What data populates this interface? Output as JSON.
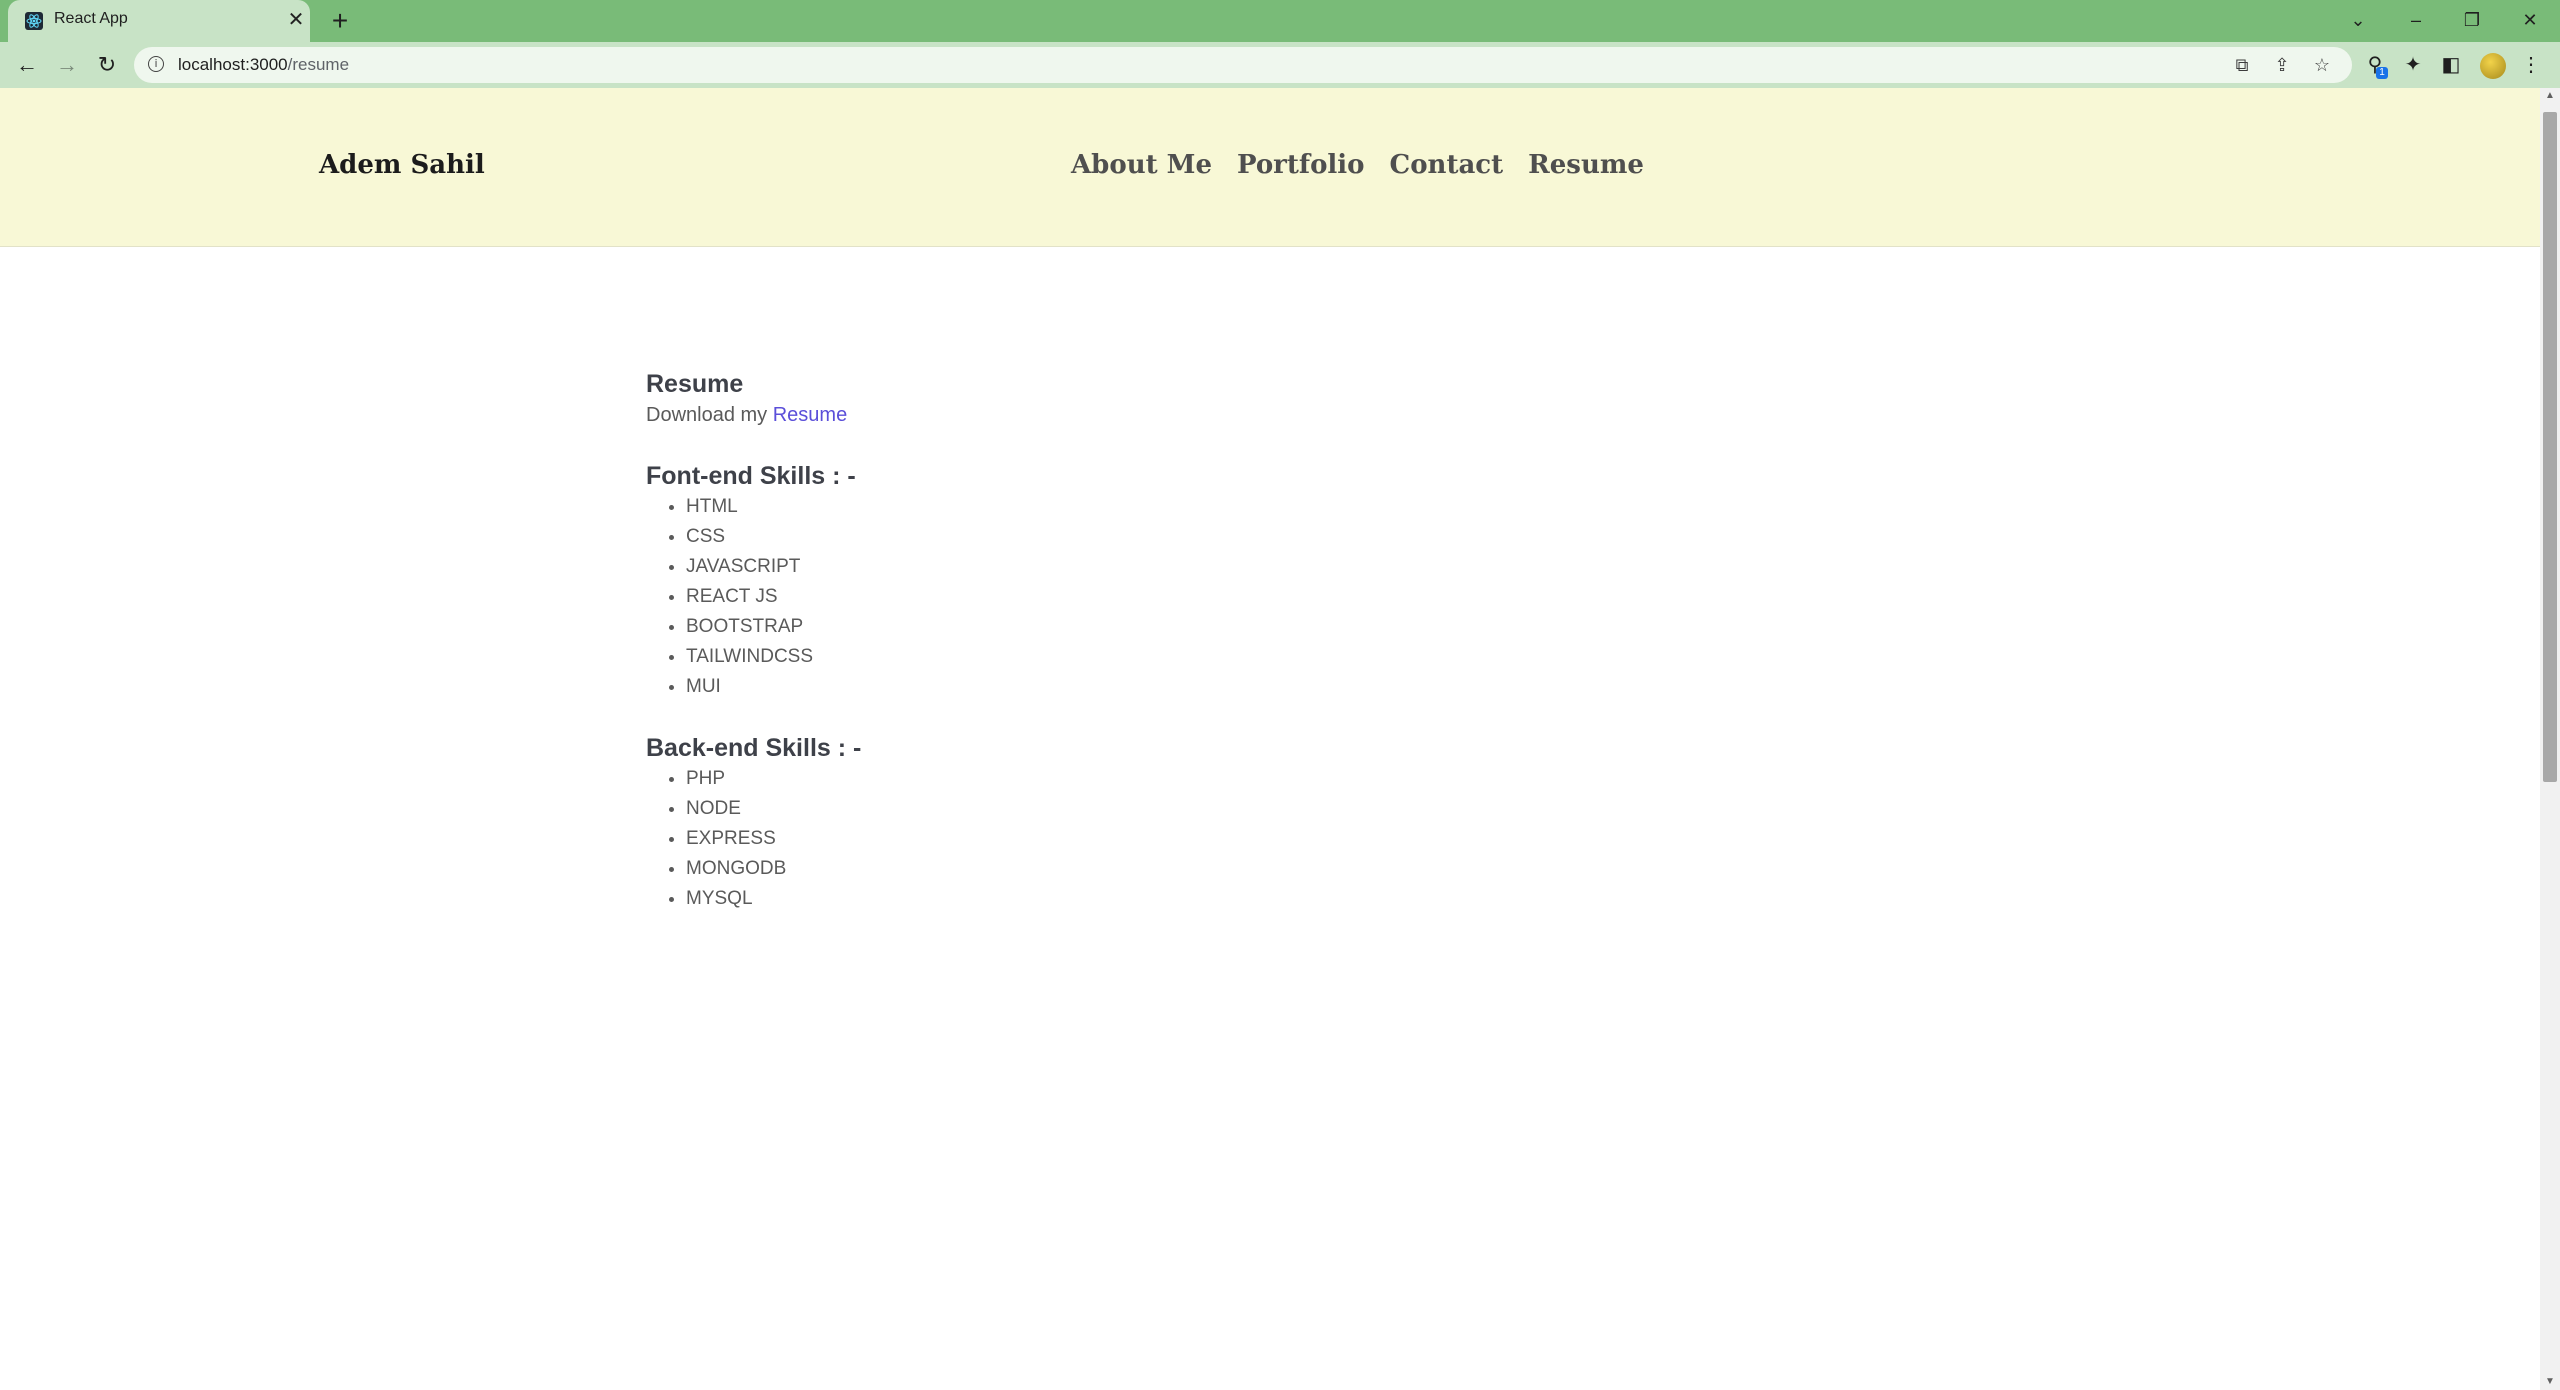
{
  "browser": {
    "tab_title": "React App",
    "new_tab_label": "+",
    "url_host": "localhost:3000",
    "url_path": "/resume",
    "extension_badge": "1"
  },
  "site": {
    "brand": "Adem Sahil",
    "nav": [
      "About Me",
      "Portfolio",
      "Contact",
      "Resume"
    ]
  },
  "resume": {
    "title": "Resume",
    "download_text": "Download my ",
    "download_link": "Resume",
    "frontend_title": "Font-end Skills : -",
    "frontend_skills": [
      "HTML",
      "CSS",
      "JAVASCRIPT",
      "REACT JS",
      "BOOTSTRAP",
      "TAILWINDCSS",
      "MUI"
    ],
    "backend_title": "Back-end Skills : -",
    "backend_skills": [
      "PHP",
      "NODE",
      "EXPRESS",
      "MONGODB",
      "MYSQL"
    ]
  },
  "colors": {
    "tabstrip": "#79bb78",
    "toolbar": "#c8e3c6",
    "header_bg": "#f8f8d6",
    "link": "#5b4fd9"
  }
}
